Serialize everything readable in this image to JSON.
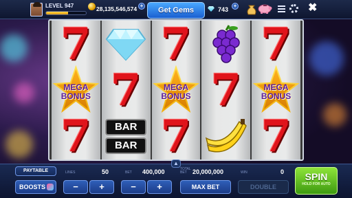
{
  "topbar": {
    "level": "LEVEL 947",
    "xp_progress": 0.55,
    "coins": "28,135,546,574",
    "get_gems_label": "Get Gems",
    "gems": "743"
  },
  "reels": [
    [
      "seven",
      "mega",
      "seven"
    ],
    [
      "diamond",
      "seven",
      "bar"
    ],
    [
      "seven",
      "mega",
      "seven"
    ],
    [
      "grapes",
      "seven",
      "banana"
    ],
    [
      "seven",
      "mega",
      "seven"
    ]
  ],
  "symbols": {
    "mega_line1": "MEGA",
    "mega_line2": "BONUS",
    "bar": "BAR",
    "seven": "7"
  },
  "bottom": {
    "paytable_label": "PAYTABLE",
    "lines_label": "LINES",
    "lines_value": "50",
    "bet_label": "BET",
    "bet_value": "400,000",
    "total_bet_label": "TOTAL BET",
    "total_bet_value": "20,000,000",
    "win_label": "WIN",
    "win_value": "0",
    "boosts_label": "BOOSTS",
    "minus": "−",
    "plus": "+",
    "max_bet_label": "MAX BET",
    "double_label": "DOUBLE",
    "spin_label": "SPIN",
    "spin_sub": "HOLD FOR AUTO"
  },
  "colors": {
    "spin_green": "#6cc620",
    "accent_blue": "#2f6fd8",
    "seven_red": "#e0141b"
  }
}
